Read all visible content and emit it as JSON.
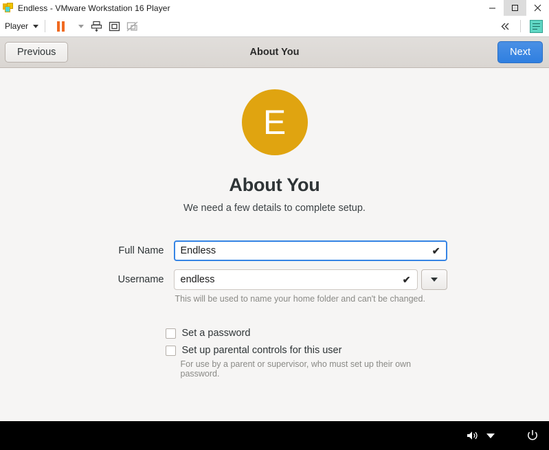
{
  "window": {
    "title": "Endless - VMware Workstation 16 Player",
    "app_icon": "vmware-icon",
    "controls": {
      "minimize": "minimize-icon",
      "maximize": "maximize-icon",
      "close": "close-icon"
    }
  },
  "toolbar": {
    "player_menu": "Player",
    "buttons": [
      {
        "name": "pause-button",
        "icon": "pause-icon"
      },
      {
        "name": "pause-dropdown",
        "icon": "chevron-down-icon"
      },
      {
        "name": "send-ctrl-alt-del-button",
        "icon": "send-key-icon"
      },
      {
        "name": "full-screen-button",
        "icon": "fullscreen-icon"
      },
      {
        "name": "unity-mode-button",
        "icon": "unity-mode-icon"
      }
    ],
    "right_buttons": [
      {
        "name": "collapse-toolbar-button",
        "icon": "double-chevron-left-icon"
      },
      {
        "name": "notes-button",
        "icon": "note-icon"
      }
    ]
  },
  "guest_header": {
    "previous_label": "Previous",
    "title": "About You",
    "next_label": "Next",
    "next_color": "#3584e4"
  },
  "page": {
    "avatar_letter": "E",
    "avatar_color": "#e0a410",
    "heading": "About You",
    "subheading": "We need a few details to complete setup."
  },
  "form": {
    "fields": [
      {
        "label": "Full Name",
        "value": "Endless",
        "placeholder": "",
        "valid_icon": "check-icon",
        "focused": true,
        "has_dropdown": false,
        "hint": ""
      },
      {
        "label": "Username",
        "value": "endless",
        "placeholder": "",
        "valid_icon": "check-icon",
        "focused": false,
        "has_dropdown": true,
        "hint": "This will be used to name your home folder and can't be changed."
      }
    ]
  },
  "options": [
    {
      "label": "Set a password",
      "checked": false,
      "description": ""
    },
    {
      "label": "Set up parental controls for this user",
      "checked": false,
      "description": "For use by a parent or supervisor, who must set up their own password."
    }
  ],
  "system_tray": {
    "volume_icon": "volume-icon",
    "menu_icon": "chevron-down-icon",
    "power_icon": "power-icon"
  }
}
